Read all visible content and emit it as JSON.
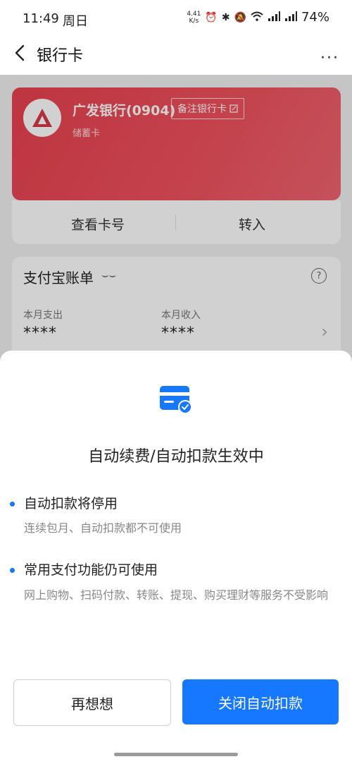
{
  "status_bar": {
    "time": "11:49",
    "day": "周日",
    "net_speed_top": "4.41",
    "net_speed_bottom": "K/s",
    "battery": "74%"
  },
  "nav": {
    "title": "银行卡",
    "more_label": "···"
  },
  "card": {
    "bank_name": "广发银行(0904)",
    "note_button": "备注银行卡",
    "card_type": "储蓄卡",
    "color": "#ea4a57"
  },
  "card_actions": {
    "view_number": "查看卡号",
    "transfer_in": "转入"
  },
  "bill": {
    "title": "支付宝账单",
    "help": "?",
    "expense_label": "本月支出",
    "expense_value": "****",
    "income_label": "本月收入",
    "income_value": "****"
  },
  "sheet": {
    "title": "自动续费/自动扣款生效中",
    "points": [
      {
        "title": "自动扣款将停用",
        "desc": "连续包月、自动扣款都不可使用"
      },
      {
        "title": "常用支付功能仍可使用",
        "desc": "网上购物、扫码付款、转账、提现、购买理财等服务不受影响"
      }
    ],
    "cancel_label": "再想想",
    "confirm_label": "关闭自动扣款",
    "accent_color": "#1677ff"
  }
}
